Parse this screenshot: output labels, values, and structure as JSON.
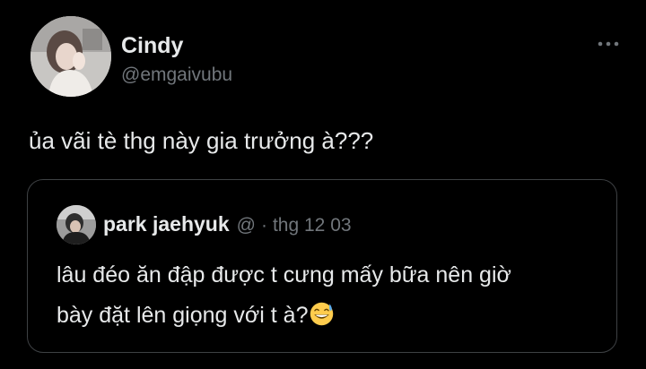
{
  "tweet": {
    "author": {
      "display_name": "Cindy",
      "handle": "@emgaivubu"
    },
    "more_icon": "more-horizontal-icon",
    "text": "ủa vãi tè thg này gia trưởng à???",
    "quoted": {
      "display_name": "park jaehyuk",
      "handle": "@",
      "separator": "·",
      "date": "thg 12 03",
      "line1": "lâu đéo ăn đập được t cưng mấy bữa nên giờ",
      "line2": "bày đặt lên giọng với t à?",
      "emoji": "grinning-face-with-sweat"
    }
  },
  "colors": {
    "background": "#000000",
    "text_primary": "#e7e9ea",
    "text_secondary": "#71767b",
    "card_border": "#3e4144"
  }
}
